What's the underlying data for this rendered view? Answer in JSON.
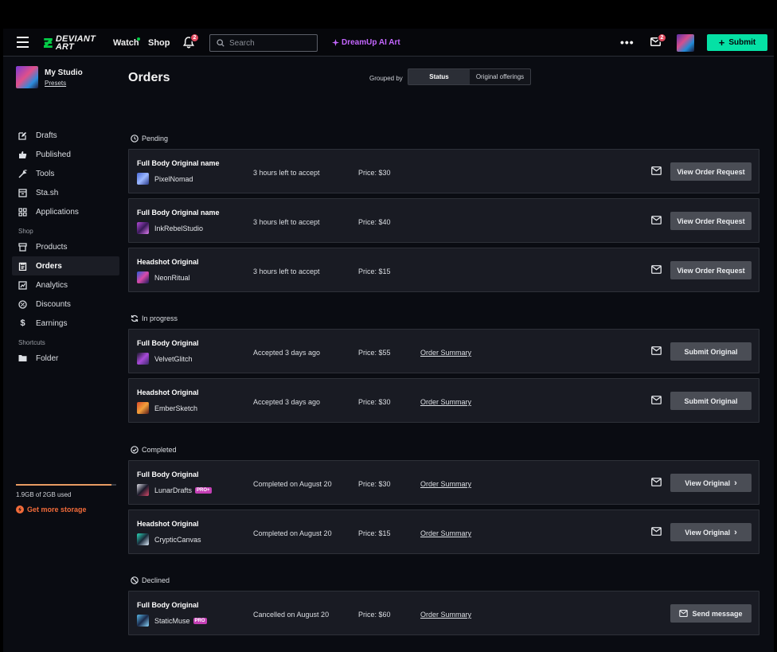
{
  "nav": {
    "brand_line1": "DEVIANT",
    "brand_line2": "ART",
    "watch": "Watch",
    "shop": "Shop",
    "notif_count": "2",
    "search_placeholder": "Search",
    "dreamup": "DreamUp AI Art",
    "more": "•••",
    "mail_count": "2",
    "submit": "Submit"
  },
  "sidebar": {
    "studio_name": "My Studio",
    "studio_sub": "Presets",
    "items_top": [
      {
        "label": "Drafts",
        "icon": "drafts-icon"
      },
      {
        "label": "Published",
        "icon": "published-icon"
      },
      {
        "label": "Tools",
        "icon": "tools-icon"
      },
      {
        "label": "Sta.sh",
        "icon": "stash-icon"
      },
      {
        "label": "Applications",
        "icon": "applications-icon"
      }
    ],
    "shop_head": "Shop",
    "items_shop": [
      {
        "label": "Products",
        "icon": "products-icon"
      },
      {
        "label": "Orders",
        "icon": "orders-icon"
      },
      {
        "label": "Analytics",
        "icon": "analytics-icon"
      },
      {
        "label": "Discounts",
        "icon": "discounts-icon"
      },
      {
        "label": "Earnings",
        "icon": "earnings-icon"
      }
    ],
    "shortcuts_head": "Shortcuts",
    "items_shortcuts": [
      {
        "label": "Folder",
        "icon": "folder-icon"
      }
    ],
    "storage_text": "1.9GB of 2GB used",
    "storage_fraction": 0.95,
    "storage_link": "Get more storage"
  },
  "main": {
    "title": "Orders",
    "grouped_by": "Grouped by",
    "seg_status": "Status",
    "seg_offerings": "Original offerings",
    "sections": {
      "pending": "Pending",
      "in_progress": "In progress",
      "completed": "Completed",
      "declined": "Declined"
    },
    "rows": [
      {
        "title": "Full Body Original name",
        "user": "PixelNomad",
        "status": "3 hours left to accept",
        "price": "Price: $30",
        "link": "",
        "button": "View Order Request",
        "tag": ""
      },
      {
        "title": "Full Body Original name",
        "user": "InkRebelStudio",
        "status": "3 hours left to accept",
        "price": "Price: $40",
        "link": "",
        "button": "View Order Request",
        "tag": ""
      },
      {
        "title": "Headshot Original",
        "user": "NeonRitual",
        "status": "3 hours left to accept",
        "price": "Price: $15",
        "link": "",
        "button": "View Order Request",
        "tag": ""
      },
      {
        "title": "Full Body Original",
        "user": "VelvetGlitch",
        "status": "Accepted 3 days ago",
        "price": "Price: $55",
        "link": "Order Summary",
        "button": "Submit Original",
        "tag": ""
      },
      {
        "title": "Headshot Original",
        "user": "EmberSketch",
        "status": "Accepted 3 days ago",
        "price": "Price: $30",
        "link": "Order Summary",
        "button": "Submit Original",
        "tag": ""
      },
      {
        "title": "Full Body Original",
        "user": "LunarDrafts",
        "status": "Completed on August 20",
        "price": "Price: $30",
        "link": "Order Summary",
        "button": "View Original",
        "tag": "PRO+"
      },
      {
        "title": "Headshot Original",
        "user": "CrypticCanvas",
        "status": "Completed on August 20",
        "price": "Price: $15",
        "link": "Order Summary",
        "button": "View Original",
        "tag": ""
      },
      {
        "title": "Full Body Original",
        "user": "StaticMuse",
        "status": "Cancelled on August 20",
        "price": "Price: $60",
        "link": "Order Summary",
        "button": "Send message",
        "tag": "PRO"
      }
    ]
  },
  "colors": {
    "accent": "#05e1a5",
    "brand": "#05cc47",
    "dreamup": "#c466ff",
    "badge": "#e04a5f",
    "storage": "#f26b3a"
  }
}
